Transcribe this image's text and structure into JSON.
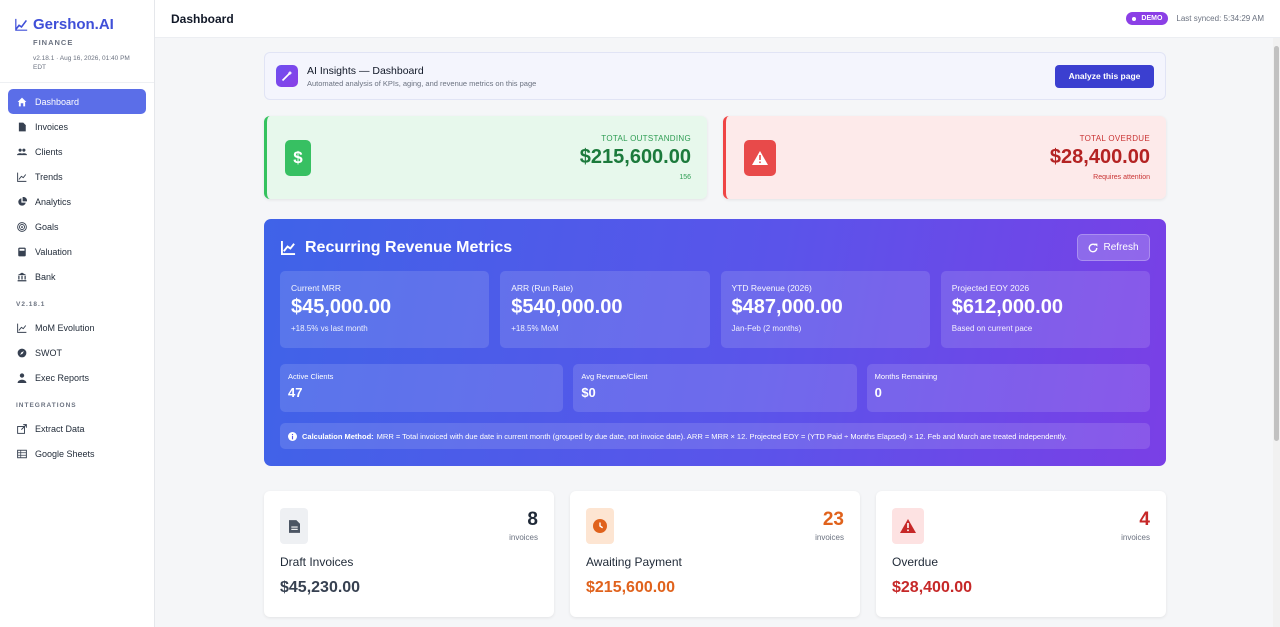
{
  "brand": {
    "name": "Gershon.AI",
    "sub": "FINANCE",
    "version": "v2.18.1 · Aug 16, 2026, 01:40 PM EDT",
    "accent": "#3f4fd8"
  },
  "sidebar": {
    "items": [
      {
        "label": "Dashboard",
        "icon": "home-icon",
        "active": true
      },
      {
        "label": "Invoices",
        "icon": "file-icon"
      },
      {
        "label": "Clients",
        "icon": "users-icon"
      },
      {
        "label": "Trends",
        "icon": "line-chart-icon"
      },
      {
        "label": "Analytics",
        "icon": "pie-chart-icon"
      },
      {
        "label": "Goals",
        "icon": "target-icon"
      },
      {
        "label": "Valuation",
        "icon": "calculator-icon"
      },
      {
        "label": "Bank",
        "icon": "bank-icon"
      }
    ],
    "section_version": "V2.18.1",
    "version_items": [
      {
        "label": "MoM Evolution",
        "icon": "line-chart-icon"
      },
      {
        "label": "SWOT",
        "icon": "compass-icon"
      },
      {
        "label": "Exec Reports",
        "icon": "user-tie-icon"
      }
    ],
    "section_integrations": "INTEGRATIONS",
    "integration_items": [
      {
        "label": "Extract Data",
        "icon": "export-icon"
      },
      {
        "label": "Google Sheets",
        "icon": "table-icon"
      }
    ]
  },
  "topbar": {
    "title": "Dashboard",
    "badge": "DEMO",
    "synced": "Last synced: 5:34:29 AM"
  },
  "ai": {
    "title": "AI Insights — Dashboard",
    "desc": "Automated analysis of KPIs, aging, and revenue metrics on this page",
    "button": "Analyze this page"
  },
  "summary": {
    "outstanding": {
      "label": "TOTAL OUTSTANDING",
      "value": "$215,600.00",
      "note": "156"
    },
    "overdue": {
      "label": "TOTAL OVERDUE",
      "value": "$28,400.00",
      "note": "Requires attention"
    }
  },
  "recurring": {
    "title": "Recurring Revenue Metrics",
    "refresh": "Refresh",
    "metrics": [
      {
        "label": "Current MRR",
        "value": "$45,000.00",
        "sub": "+18.5% vs last month"
      },
      {
        "label": "ARR (Run Rate)",
        "value": "$540,000.00",
        "sub": "+18.5% MoM"
      },
      {
        "label": "YTD Revenue (2026)",
        "value": "$487,000.00",
        "sub": "Jan-Feb (2 months)"
      },
      {
        "label": "Projected EOY 2026",
        "value": "$612,000.00",
        "sub": "Based on current pace"
      }
    ],
    "small": [
      {
        "label": "Active Clients",
        "value": "47"
      },
      {
        "label": "Avg Revenue/Client",
        "value": "$0"
      },
      {
        "label": "Months Remaining",
        "value": "0"
      }
    ],
    "calc_label": "Calculation Method:",
    "calc_text": "MRR = Total invoiced with due date in current month (grouped by due date, not invoice date). ARR = MRR × 12. Projected EOY = (YTD Paid ÷ Months Elapsed) × 12. Feb and March are treated independently."
  },
  "status": [
    {
      "title": "Draft Invoices",
      "count": "8",
      "unit": "invoices",
      "amount": "$45,230.00",
      "color": "#1f2937",
      "icon_bg": "#eef0f3"
    },
    {
      "title": "Awaiting Payment",
      "count": "23",
      "unit": "invoices",
      "amount": "$215,600.00",
      "color": "#e0621c",
      "icon_bg": "#fde5d2"
    },
    {
      "title": "Overdue",
      "count": "4",
      "unit": "invoices",
      "amount": "$28,400.00",
      "color": "#c62828",
      "icon_bg": "#fde2e2"
    }
  ]
}
